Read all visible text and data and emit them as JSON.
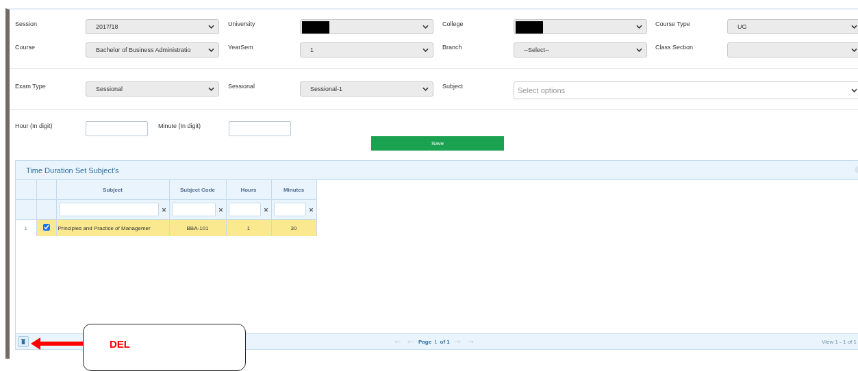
{
  "form_sections": [
    {
      "rows": [
        [
          {
            "label": "Session",
            "kind": "select",
            "value": "2017/18"
          },
          {
            "label": "University",
            "kind": "select",
            "redacted": true
          },
          {
            "label": "College",
            "kind": "select",
            "redacted": true
          },
          {
            "label": "Course Type",
            "kind": "select",
            "value": "UG"
          }
        ],
        [
          {
            "label": "Course",
            "kind": "select",
            "value": "Bachelor of Business Administratio"
          },
          {
            "label": "YearSem",
            "kind": "select",
            "value": "1"
          },
          {
            "label": "Branch",
            "kind": "select",
            "value": "--Select--"
          },
          {
            "label": "Class Section",
            "kind": "select"
          }
        ]
      ]
    },
    {
      "rows": [
        [
          {
            "label": "Exam Type",
            "kind": "select",
            "value": "Sessional"
          },
          {
            "label": "Sessional",
            "kind": "select",
            "value": "Sessional-1"
          },
          {
            "label": "Subject",
            "kind": "multiselect",
            "placeholder": "Select options"
          }
        ]
      ]
    },
    {
      "rows": [
        [
          {
            "label": "Hour (In digit)",
            "kind": "input"
          },
          {
            "label": "Minute (In digit)",
            "kind": "input"
          }
        ]
      ]
    }
  ],
  "save_button": "Save",
  "grid": {
    "title": "Time Duration Set Subject's",
    "columns": [
      "Subject",
      "Subject Code",
      "Hours",
      "Minutes"
    ],
    "rows": [
      {
        "number": "1",
        "checked": true,
        "selected": true,
        "cells": [
          "Principles and Practice of Managemer",
          "BBA-101",
          "1",
          "30"
        ]
      }
    ],
    "pager": {
      "page_label": "Page",
      "page": "1",
      "of": "of 1",
      "view": "View 1 - 1 of 1"
    }
  },
  "annotation": {
    "text": "DEL"
  }
}
